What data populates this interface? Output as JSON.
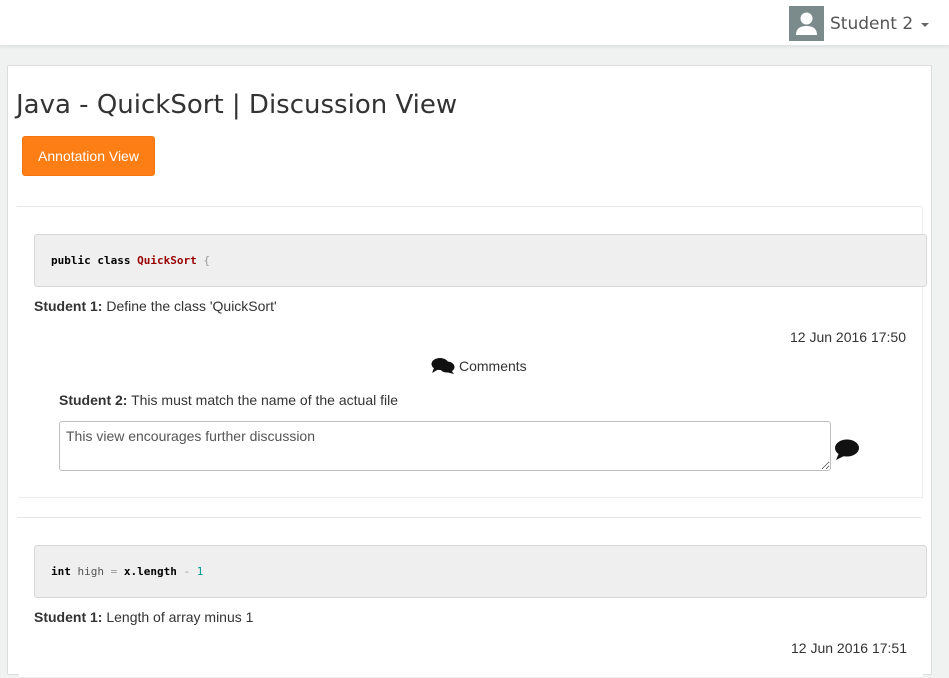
{
  "header": {
    "user_name": "Student 2"
  },
  "page": {
    "title": "Java - QuickSort | Discussion View",
    "annotation_view_label": "Annotation View"
  },
  "annotations": [
    {
      "code": {
        "kw1": "public",
        "kw2": "class",
        "ident": "QuickSort",
        "punct": "{"
      },
      "author": "Student 1:",
      "text": "Define the class 'QuickSort'",
      "timestamp": "12 Jun 2016 17:50",
      "comments_label": "Comments",
      "comments": [
        {
          "author": "Student 2:",
          "text": "This must match the name of the actual file"
        }
      ],
      "reply_value": "This view encourages further discussion"
    },
    {
      "code": {
        "kw": "int",
        "var": "high",
        "op": "=",
        "obj": "x",
        "prop": ".length",
        "minus": "-",
        "num": "1"
      },
      "author": "Student 1:",
      "text": "Length of array minus 1",
      "timestamp": "12 Jun 2016 17:51"
    }
  ],
  "colors": {
    "accent": "#fd7e14",
    "avatar_bg": "#7b8a8b"
  },
  "icons": {
    "avatar": "user-icon",
    "caret": "caret-down-icon",
    "comments": "comments-icon",
    "send": "comment-icon"
  }
}
